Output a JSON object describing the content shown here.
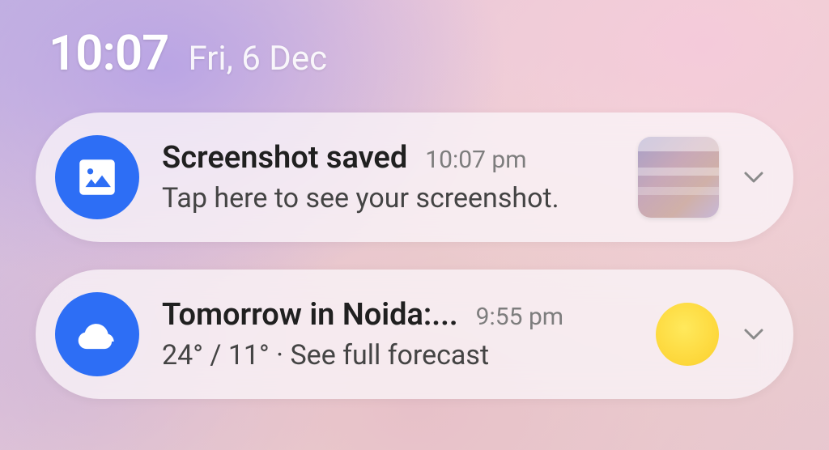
{
  "status": {
    "time": "10:07",
    "date": "Fri, 6 Dec"
  },
  "notifications": [
    {
      "app_icon": "picture-icon",
      "title": "Screenshot saved",
      "timestamp": "10:07 pm",
      "body": "Tap here to see your screenshot.",
      "side": "thumbnail"
    },
    {
      "app_icon": "cloud-icon",
      "title": "Tomorrow in Noida:...",
      "timestamp": "9:55 pm",
      "body": "24° / 11° · See full forecast",
      "side": "sun"
    }
  ],
  "colors": {
    "icon_bg": "#2d6ef5",
    "sun": "#fdd73a"
  }
}
